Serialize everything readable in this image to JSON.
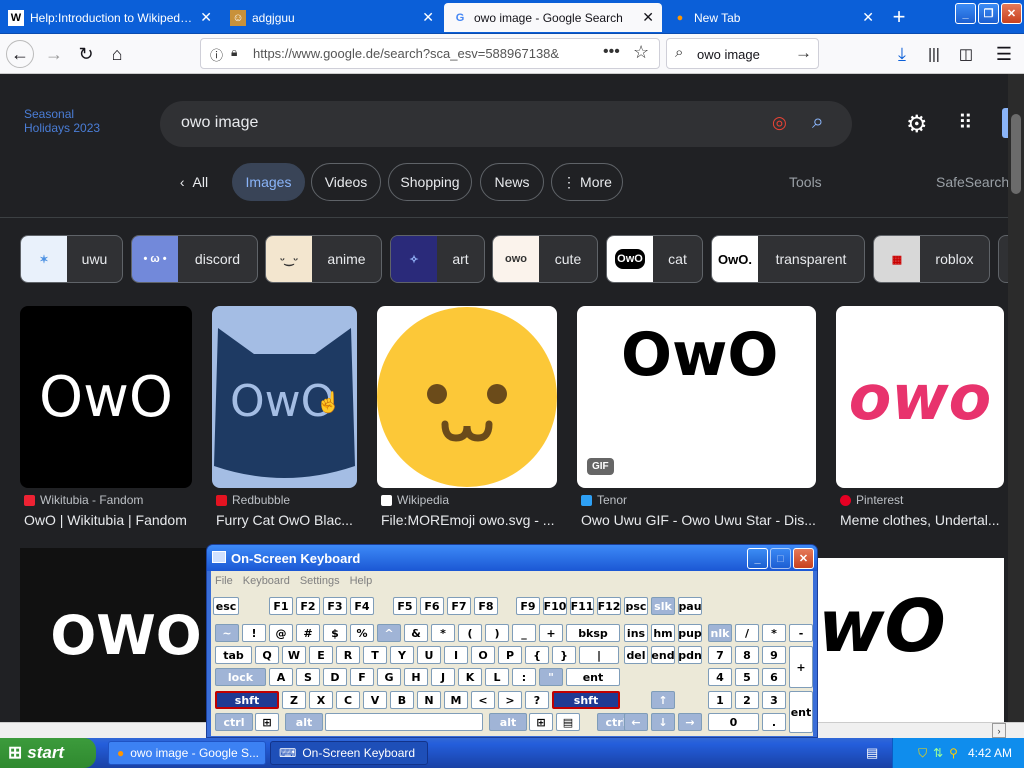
{
  "browser": {
    "tabs": [
      {
        "title": "Help:Introduction to Wikipedia - W",
        "icon": "wikipedia-icon"
      },
      {
        "title": "adgjguu",
        "icon": "page-icon"
      },
      {
        "title": "owo image - Google Search",
        "icon": "google-icon"
      },
      {
        "title": "New Tab",
        "icon": "firefox-icon"
      }
    ],
    "url": "https://www.google.de/search?sca_esv=588967138&",
    "search_value": "owo image"
  },
  "google": {
    "doodle_text_1": "Seasonal",
    "doodle_text_2": "Holidays 2023",
    "query": "owo image",
    "filters": [
      "All",
      "Images",
      "Videos",
      "Shopping",
      "News",
      "More"
    ],
    "tools": "Tools",
    "safesearch": "SafeSearch",
    "chips": [
      "uwu",
      "discord",
      "anime",
      "art",
      "cute",
      "cat",
      "transparent",
      "roblox"
    ],
    "chip_thumbs": [
      "",
      "",
      "",
      "",
      "",
      "OwO",
      "OwO.",
      ""
    ],
    "results": [
      {
        "text": "OwO",
        "source": "Wikitubia - Fandom",
        "title": "OwO | Wikitubia | Fandom"
      },
      {
        "text": "OwO",
        "source": "Redbubble",
        "title": "Furry Cat OwO Blac..."
      },
      {
        "text": "",
        "source": "Wikipedia",
        "title": "File:MOREmoji owo.svg - ..."
      },
      {
        "text": "OwO",
        "badge": "GIF",
        "source": "Tenor",
        "title": "Owo Uwu GIF - Owo Uwu Star - Dis..."
      },
      {
        "text": "owo",
        "source": "Pinterest",
        "title": "Meme clothes, Undertal..."
      }
    ],
    "row2": [
      "OWO",
      "wO"
    ]
  },
  "osk": {
    "title": "On-Screen Keyboard",
    "menu": [
      "File",
      "Keyboard",
      "Settings",
      "Help"
    ],
    "row1": [
      "esc",
      "F1",
      "F2",
      "F3",
      "F4",
      "F5",
      "F6",
      "F7",
      "F8",
      "F9",
      "F10",
      "F11",
      "F12",
      "psc",
      "slk",
      "pau"
    ],
    "row2": [
      "~",
      "!",
      "@",
      "#",
      "$",
      "%",
      "^",
      "&",
      "*",
      "(",
      ")",
      "_",
      "+",
      "bksp",
      "ins",
      "hm",
      "pup",
      "nlk",
      "/",
      "*",
      "-"
    ],
    "row3": [
      "tab",
      "Q",
      "W",
      "E",
      "R",
      "T",
      "Y",
      "U",
      "I",
      "O",
      "P",
      "{",
      "}",
      "|",
      "del",
      "end",
      "pdn",
      "7",
      "8",
      "9",
      "+"
    ],
    "row4": [
      "lock",
      "A",
      "S",
      "D",
      "F",
      "G",
      "H",
      "J",
      "K",
      "L",
      ":",
      "\"",
      "ent",
      "4",
      "5",
      "6"
    ],
    "row5": [
      "shft",
      "Z",
      "X",
      "C",
      "V",
      "B",
      "N",
      "M",
      "<",
      ">",
      "?",
      "shft",
      "↑",
      "1",
      "2",
      "3",
      "ent"
    ],
    "row6": [
      "ctrl",
      "alt",
      "alt",
      "ctrl",
      "←",
      "↓",
      "→",
      "0",
      "."
    ]
  },
  "taskbar": {
    "start": "start",
    "tasks": [
      "owo image - Google S...",
      "On-Screen Keyboard"
    ],
    "clock": "4:42 AM"
  },
  "colors": {
    "xp_blue": "#245edb",
    "google_bg": "#202124",
    "accent_blue": "#8ab4f8"
  }
}
